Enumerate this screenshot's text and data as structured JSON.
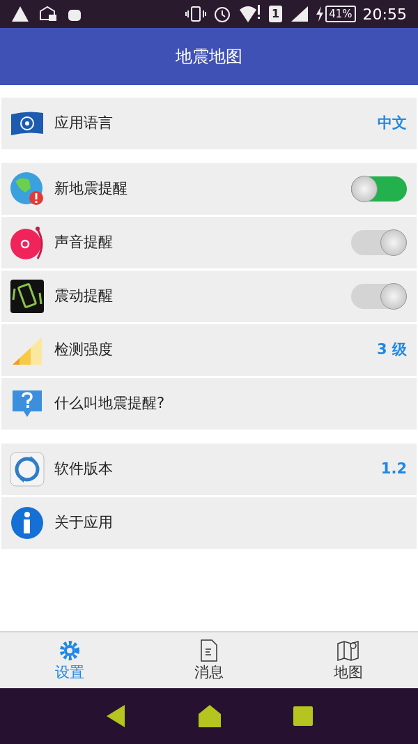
{
  "status_bar": {
    "sim": "1",
    "battery": "41%",
    "time": "20:55"
  },
  "header": {
    "title": "地震地图"
  },
  "groups": [
    [
      {
        "label": "应用语言",
        "kind": "value",
        "value": "中文"
      }
    ],
    [
      {
        "label": "新地震提醒",
        "kind": "toggle",
        "on": true
      },
      {
        "label": "声音提醒",
        "kind": "toggle",
        "on": false
      },
      {
        "label": "震动提醒",
        "kind": "toggle",
        "on": false
      },
      {
        "label": "检测强度",
        "kind": "value",
        "value": "3 级"
      },
      {
        "label": "什么叫地震提醒?",
        "kind": "plain"
      }
    ],
    [
      {
        "label": "软件版本",
        "kind": "value",
        "value": "1.2"
      },
      {
        "label": "关于应用",
        "kind": "plain"
      }
    ]
  ],
  "tabs": [
    {
      "label": "设置",
      "selected": true
    },
    {
      "label": "消息",
      "selected": false
    },
    {
      "label": "地图",
      "selected": false
    }
  ]
}
